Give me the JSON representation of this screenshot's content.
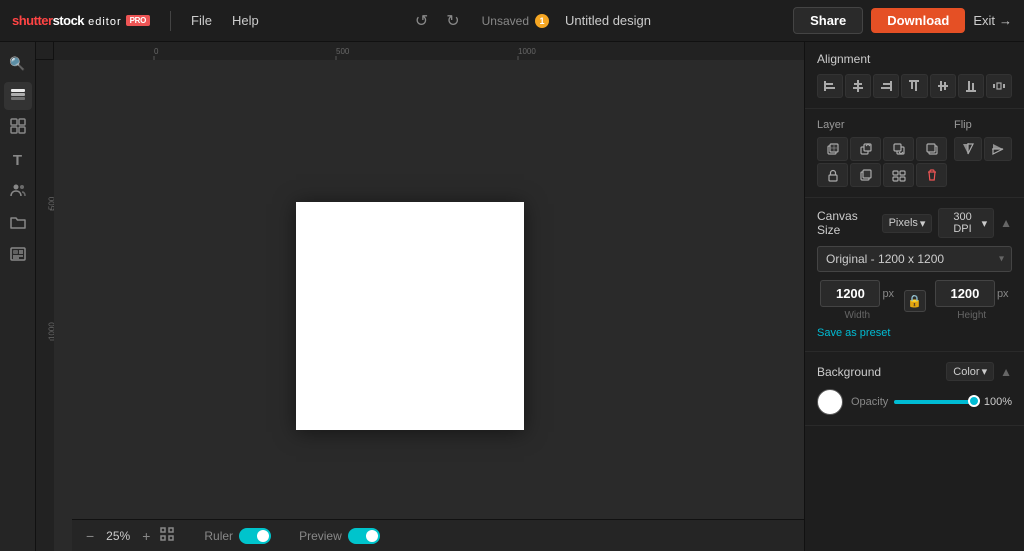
{
  "topbar": {
    "logo": "shutterstock",
    "logo_editor": "editor",
    "logo_badge": "PRO",
    "nav": {
      "file": "File",
      "help": "Help"
    },
    "unsaved_label": "Unsaved",
    "unsaved_count": "1",
    "design_title": "Untitled design",
    "share_label": "Share",
    "download_label": "Download",
    "exit_label": "Exit"
  },
  "sidebar": {
    "tools": [
      {
        "id": "search",
        "icon": "🔍"
      },
      {
        "id": "layers",
        "icon": "▤"
      },
      {
        "id": "grid",
        "icon": "▦"
      },
      {
        "id": "text",
        "icon": "T"
      },
      {
        "id": "people",
        "icon": "👥"
      },
      {
        "id": "folder",
        "icon": "📁"
      },
      {
        "id": "media",
        "icon": "▣"
      }
    ]
  },
  "panel": {
    "alignment": {
      "title": "Alignment",
      "buttons": [
        "align-left",
        "align-center-h",
        "align-right",
        "align-top",
        "align-center-v",
        "align-bottom",
        "distribute"
      ]
    },
    "layer": {
      "title": "Layer",
      "buttons": [
        "bring-front",
        "bring-forward",
        "send-backward",
        "send-back",
        "lock",
        "duplicate",
        "group",
        "delete"
      ]
    },
    "flip": {
      "title": "Flip",
      "buttons": [
        "flip-h",
        "flip-v"
      ]
    },
    "canvas_size": {
      "title": "Canvas Size",
      "unit": "Pixels",
      "dpi": "300 DPI",
      "preset": "Original - 1200 x 1200",
      "width": "1200",
      "height": "1200",
      "unit_label": "px",
      "width_label": "Width",
      "height_label": "Height",
      "save_preset": "Save as preset"
    },
    "background": {
      "title": "Background",
      "type": "Color",
      "opacity_label": "Opacity",
      "opacity_value": "100%"
    }
  },
  "bottombar": {
    "zoom_level": "25%",
    "ruler_label": "Ruler",
    "preview_label": "Preview"
  }
}
